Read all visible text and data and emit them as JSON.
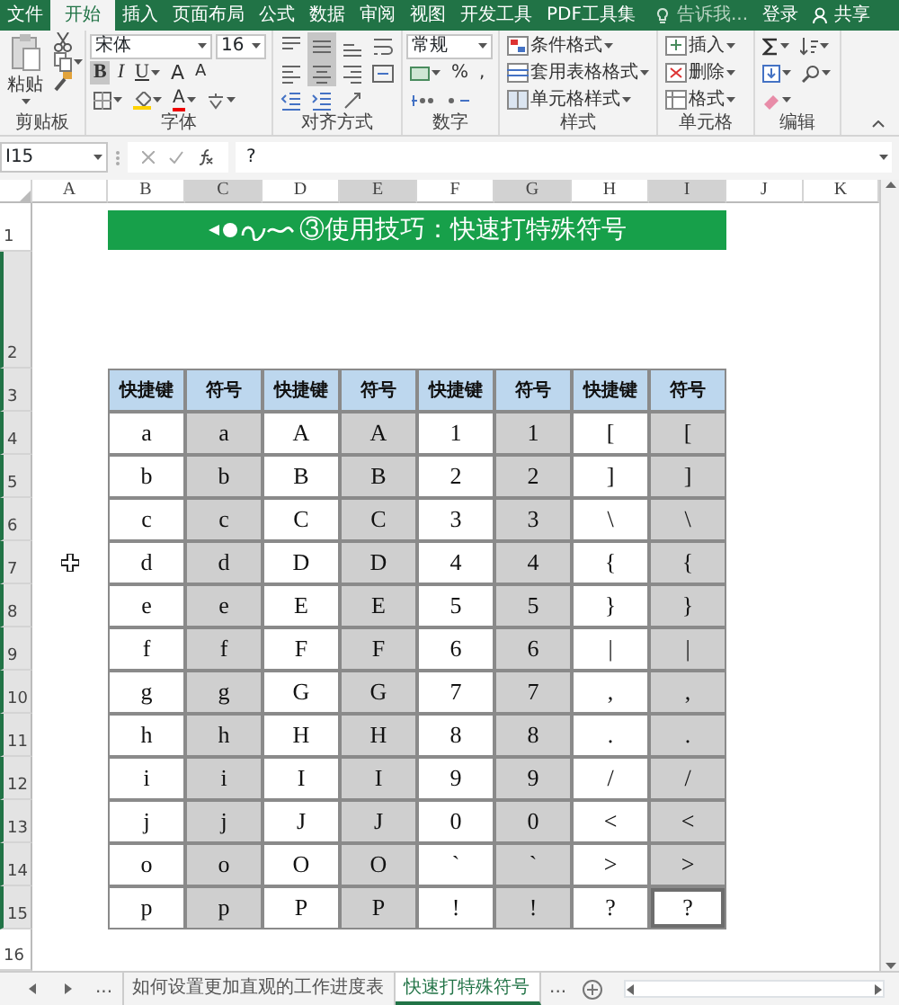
{
  "ribbon_tabs": [
    {
      "label": "文件",
      "selected": false
    },
    {
      "label": "开始",
      "selected": true
    },
    {
      "label": "插入",
      "selected": false
    },
    {
      "label": "页面布局",
      "selected": false
    },
    {
      "label": "公式",
      "selected": false
    },
    {
      "label": "数据",
      "selected": false
    },
    {
      "label": "审阅",
      "selected": false
    },
    {
      "label": "视图",
      "selected": false
    },
    {
      "label": "开发工具",
      "selected": false
    },
    {
      "label": "PDF工具集",
      "selected": false
    }
  ],
  "tell_me": "告诉我...",
  "sign_in": "登录",
  "share": "共享",
  "ribbon": {
    "clipboard": {
      "label": "剪贴板",
      "paste": "粘贴"
    },
    "font": {
      "label": "字体",
      "font_name": "宋体",
      "font_size": "16",
      "bold": {
        "text": "B",
        "selected": true
      },
      "italic": {
        "text": "I",
        "selected": false
      },
      "underline": {
        "text": "U",
        "selected": false
      },
      "grow": "A",
      "shrink": "A",
      "font_color": "A"
    },
    "alignment": {
      "label": "对齐方式",
      "buttons": [
        {
          "kind": "top",
          "selected": false
        },
        {
          "kind": "middle",
          "selected": true
        },
        {
          "kind": "bottom",
          "selected": false
        },
        {
          "kind": "wrap",
          "selected": false
        },
        {
          "kind": "left",
          "selected": false
        },
        {
          "kind": "center",
          "selected": true
        },
        {
          "kind": "right",
          "selected": false
        },
        {
          "kind": "merge",
          "selected": false
        },
        {
          "kind": "outdent",
          "selected": false
        },
        {
          "kind": "indent",
          "selected": false
        },
        {
          "kind": "orientation",
          "selected": false
        }
      ]
    },
    "number": {
      "label": "数字",
      "format": "常规",
      "percent": "%",
      "comma": ","
    },
    "styles": {
      "label": "样式",
      "items": [
        "条件格式",
        "套用表格格式",
        "单元格样式"
      ]
    },
    "cells": {
      "label": "单元格",
      "items": [
        "插入",
        "删除",
        "格式"
      ]
    },
    "editing": {
      "label": "编辑"
    }
  },
  "name_box": "I15",
  "formula": "?",
  "columns": [
    {
      "label": "A",
      "highlighted": false
    },
    {
      "label": "B",
      "highlighted": false
    },
    {
      "label": "C",
      "highlighted": true
    },
    {
      "label": "D",
      "highlighted": false
    },
    {
      "label": "E",
      "highlighted": true
    },
    {
      "label": "F",
      "highlighted": false
    },
    {
      "label": "G",
      "highlighted": true
    },
    {
      "label": "H",
      "highlighted": false
    },
    {
      "label": "I",
      "highlighted": true
    },
    {
      "label": "J",
      "highlighted": false
    },
    {
      "label": "K",
      "highlighted": false
    }
  ],
  "rows": [
    {
      "label": "1",
      "highlighted": false
    },
    {
      "label": "2",
      "highlighted": true
    },
    {
      "label": "3",
      "highlighted": true
    },
    {
      "label": "4",
      "highlighted": true
    },
    {
      "label": "5",
      "highlighted": true
    },
    {
      "label": "6",
      "highlighted": true
    },
    {
      "label": "7",
      "highlighted": true
    },
    {
      "label": "8",
      "highlighted": true
    },
    {
      "label": "9",
      "highlighted": true
    },
    {
      "label": "10",
      "highlighted": true
    },
    {
      "label": "11",
      "highlighted": true
    },
    {
      "label": "12",
      "highlighted": true
    },
    {
      "label": "13",
      "highlighted": true
    },
    {
      "label": "14",
      "highlighted": true
    },
    {
      "label": "15",
      "highlighted": true
    },
    {
      "label": "16",
      "highlighted": false
    }
  ],
  "banner": "③使用技巧：快速打特殊符号",
  "table": {
    "header": [
      "快捷键",
      "符号",
      "快捷键",
      "符号",
      "快捷键",
      "符号",
      "快捷键",
      "符号"
    ],
    "rows": [
      [
        {
          "text": "a",
          "selected": false
        },
        {
          "text": "a",
          "selected": false
        },
        {
          "text": "A",
          "selected": false
        },
        {
          "text": "A",
          "selected": false
        },
        {
          "text": "1",
          "selected": false
        },
        {
          "text": "1",
          "selected": false
        },
        {
          "text": "[",
          "selected": false
        },
        {
          "text": "[",
          "selected": false
        }
      ],
      [
        {
          "text": "b",
          "selected": false
        },
        {
          "text": "b",
          "selected": false
        },
        {
          "text": "B",
          "selected": false
        },
        {
          "text": "B",
          "selected": false
        },
        {
          "text": "2",
          "selected": false
        },
        {
          "text": "2",
          "selected": false
        },
        {
          "text": "]",
          "selected": false
        },
        {
          "text": "]",
          "selected": false
        }
      ],
      [
        {
          "text": "c",
          "selected": false
        },
        {
          "text": "c",
          "selected": false
        },
        {
          "text": "C",
          "selected": false
        },
        {
          "text": "C",
          "selected": false
        },
        {
          "text": "3",
          "selected": false
        },
        {
          "text": "3",
          "selected": false
        },
        {
          "text": "\\",
          "selected": false
        },
        {
          "text": "\\",
          "selected": false
        }
      ],
      [
        {
          "text": "d",
          "selected": false
        },
        {
          "text": "d",
          "selected": false
        },
        {
          "text": "D",
          "selected": false
        },
        {
          "text": "D",
          "selected": false
        },
        {
          "text": "4",
          "selected": false
        },
        {
          "text": "4",
          "selected": false
        },
        {
          "text": "{",
          "selected": false
        },
        {
          "text": "{",
          "selected": false
        }
      ],
      [
        {
          "text": "e",
          "selected": false
        },
        {
          "text": "e",
          "selected": false
        },
        {
          "text": "E",
          "selected": false
        },
        {
          "text": "E",
          "selected": false
        },
        {
          "text": "5",
          "selected": false
        },
        {
          "text": "5",
          "selected": false
        },
        {
          "text": "}",
          "selected": false
        },
        {
          "text": "}",
          "selected": false
        }
      ],
      [
        {
          "text": "f",
          "selected": false
        },
        {
          "text": "f",
          "selected": false
        },
        {
          "text": "F",
          "selected": false
        },
        {
          "text": "F",
          "selected": false
        },
        {
          "text": "6",
          "selected": false
        },
        {
          "text": "6",
          "selected": false
        },
        {
          "text": "|",
          "selected": false
        },
        {
          "text": "|",
          "selected": false
        }
      ],
      [
        {
          "text": "g",
          "selected": false
        },
        {
          "text": "g",
          "selected": false
        },
        {
          "text": "G",
          "selected": false
        },
        {
          "text": "G",
          "selected": false
        },
        {
          "text": "7",
          "selected": false
        },
        {
          "text": "7",
          "selected": false
        },
        {
          "text": ",",
          "selected": false
        },
        {
          "text": ",",
          "selected": false
        }
      ],
      [
        {
          "text": "h",
          "selected": false
        },
        {
          "text": "h",
          "selected": false
        },
        {
          "text": "H",
          "selected": false
        },
        {
          "text": "H",
          "selected": false
        },
        {
          "text": "8",
          "selected": false
        },
        {
          "text": "8",
          "selected": false
        },
        {
          "text": ".",
          "selected": false
        },
        {
          "text": ".",
          "selected": false
        }
      ],
      [
        {
          "text": "i",
          "selected": false
        },
        {
          "text": "i",
          "selected": false
        },
        {
          "text": "I",
          "selected": false
        },
        {
          "text": "I",
          "selected": false
        },
        {
          "text": "9",
          "selected": false
        },
        {
          "text": "9",
          "selected": false
        },
        {
          "text": "/",
          "selected": false
        },
        {
          "text": "/",
          "selected": false
        }
      ],
      [
        {
          "text": "j",
          "selected": false
        },
        {
          "text": "j",
          "selected": false
        },
        {
          "text": "J",
          "selected": false
        },
        {
          "text": "J",
          "selected": false
        },
        {
          "text": "0",
          "selected": false
        },
        {
          "text": "0",
          "selected": false
        },
        {
          "text": "<",
          "selected": false
        },
        {
          "text": "<",
          "selected": false
        }
      ],
      [
        {
          "text": "o",
          "selected": false
        },
        {
          "text": "o",
          "selected": false
        },
        {
          "text": "O",
          "selected": false
        },
        {
          "text": "O",
          "selected": false
        },
        {
          "text": "`",
          "selected": false
        },
        {
          "text": "`",
          "selected": false
        },
        {
          "text": ">",
          "selected": false
        },
        {
          "text": ">",
          "selected": false
        }
      ],
      [
        {
          "text": "p",
          "selected": false
        },
        {
          "text": "p",
          "selected": false
        },
        {
          "text": "P",
          "selected": false
        },
        {
          "text": "P",
          "selected": false
        },
        {
          "text": "!",
          "selected": false
        },
        {
          "text": "!",
          "selected": false
        },
        {
          "text": "?",
          "selected": false
        },
        {
          "text": "?",
          "selected": true
        }
      ]
    ]
  },
  "sheet_nav_more": "...",
  "sheet_tabs": [
    {
      "label": "如何设置更加直观的工作进度表",
      "selected": false
    },
    {
      "label": "快速打特殊符号",
      "selected": true
    }
  ],
  "sheet_tabs_more": "..."
}
